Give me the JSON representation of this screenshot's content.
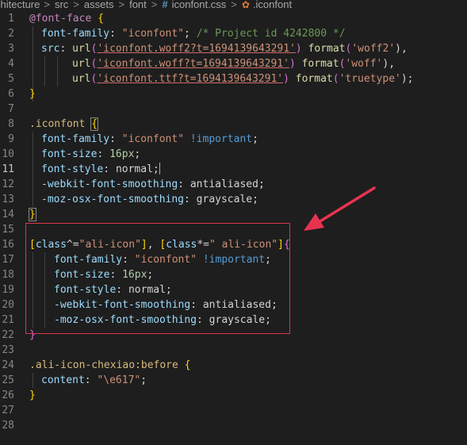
{
  "breadcrumb": {
    "items": [
      "chitecture",
      "src",
      "assets",
      "font"
    ],
    "separator": ">",
    "file_name": "iconfont.css",
    "file_icon": "hash-icon",
    "symbol_name": ".iconfont",
    "symbol_icon": "css-selector-icon"
  },
  "gutter": [
    "1",
    "2",
    "3",
    "4",
    "5",
    "6",
    "7",
    "8",
    "9",
    "10",
    "11",
    "12",
    "13",
    "14",
    "15",
    "16",
    "17",
    "18",
    "19",
    "20",
    "21",
    "22",
    "23",
    "24",
    "25",
    "26",
    "27",
    "28"
  ],
  "active_line": "11",
  "code": {
    "l1": {
      "at": "@font-face",
      "brace": "{"
    },
    "l2": {
      "prop": "font-family",
      "colon": ": ",
      "str": "\"iconfont\"",
      "semi": ";",
      "comment": "/* Project id 4242800 */"
    },
    "l3": {
      "prop": "src",
      "colon": ": ",
      "fn": "url",
      "open": "(",
      "str": "'iconfont.woff2?t=1694139643291'",
      "close": ")",
      "fn2": "format",
      "open2": "(",
      "str2": "'woff2'",
      "close2": "),"
    },
    "l4": {
      "fn": "url",
      "open": "(",
      "str": "'iconfont.woff?t=1694139643291'",
      "close": ")",
      "fn2": "format",
      "open2": "(",
      "str2": "'woff'",
      "close2": "),"
    },
    "l5": {
      "fn": "url",
      "open": "(",
      "str": "'iconfont.ttf?t=1694139643291'",
      "close": ")",
      "fn2": "format",
      "open2": "(",
      "str2": "'truetype'",
      "close2": ");"
    },
    "l6": {
      "brace": "}"
    },
    "l8": {
      "sel": ".iconfont",
      "brace": "{"
    },
    "l9": {
      "prop": "font-family",
      "colon": ": ",
      "str": "\"iconfont\"",
      "imp": "!important",
      "semi": ";"
    },
    "l10": {
      "prop": "font-size",
      "colon": ": ",
      "num": "16px",
      "semi": ";"
    },
    "l11": {
      "prop": "font-style",
      "colon": ": ",
      "val": "normal",
      "semi": ";"
    },
    "l12": {
      "prop": "-webkit-font-smoothing",
      "colon": ": ",
      "val": "antialiased",
      "semi": ";"
    },
    "l13": {
      "prop": "-moz-osx-font-smoothing",
      "colon": ": ",
      "val": "grayscale",
      "semi": ";"
    },
    "l14": {
      "brace": "}"
    },
    "l16": {
      "b1": "[",
      "attr1": "class",
      "op1": "^=",
      "v1": "\"ali-icon\"",
      "b2": "]",
      "comma": ", ",
      "b3": "[",
      "attr2": "class",
      "op2": "*=",
      "v2": "\" ali-icon\"",
      "b4": "]",
      "brace": "{"
    },
    "l17": {
      "prop": "font-family",
      "colon": ": ",
      "str": "\"iconfont\"",
      "imp": "!important",
      "semi": ";"
    },
    "l18": {
      "prop": "font-size",
      "colon": ": ",
      "num": "16px",
      "semi": ";"
    },
    "l19": {
      "prop": "font-style",
      "colon": ": ",
      "val": "normal",
      "semi": ";"
    },
    "l20": {
      "prop": "-webkit-font-smoothing",
      "colon": ": ",
      "val": "antialiased",
      "semi": ";"
    },
    "l21": {
      "prop": "-moz-osx-font-smoothing",
      "colon": ": ",
      "val": "grayscale",
      "semi": ";"
    },
    "l22": {
      "brace": "}"
    },
    "l24": {
      "sel": ".ali-icon-chexiao:before",
      "brace": "{"
    },
    "l25": {
      "prop": "content",
      "colon": ": ",
      "str": "\"\\e617\"",
      "semi": ";"
    },
    "l26": {
      "brace": "}"
    }
  },
  "annotation": {
    "box_color": "#e0334f",
    "arrow_color": "#e8334f"
  }
}
